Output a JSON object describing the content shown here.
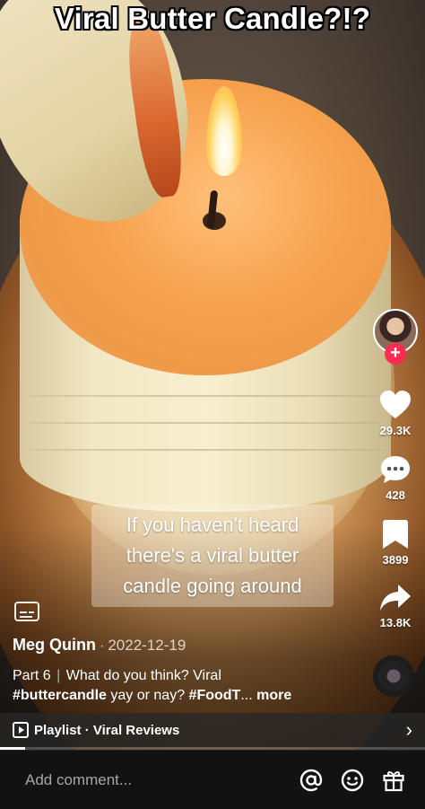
{
  "overlay_title": "Viral Butter Candle?!?",
  "caption_lines": [
    "If you haven't heard",
    "there's a viral butter",
    "candle going around"
  ],
  "creator": {
    "name": "Meg Quinn",
    "date": "2022-12-19",
    "follow_symbol": "+"
  },
  "description": {
    "part": "Part 6",
    "separator": "|",
    "text": "What do you think? Viral",
    "hashtag1": "#buttercandle",
    "text2": "yay or nay?",
    "hashtag2": "#FoodT",
    "ellipsis": "...",
    "more": "more"
  },
  "actions": {
    "likes": "29.3K",
    "comments": "428",
    "saves": "3899",
    "shares": "13.8K"
  },
  "playlist": {
    "label": "Playlist · Viral Reviews",
    "chevron": "›"
  },
  "progress_fraction": 0.06,
  "comment_bar": {
    "placeholder": "Add comment..."
  },
  "colors": {
    "follow_badge": "#fe2c55",
    "comment_bar_bg": "#121212",
    "playlist_bar_bg": "#282828"
  },
  "icons": [
    "closed-captions-icon",
    "heart-icon",
    "comment-icon",
    "bookmark-icon",
    "share-icon",
    "music-disc-icon",
    "playlist-icon",
    "mention-icon",
    "emoji-icon",
    "gift-icon"
  ]
}
